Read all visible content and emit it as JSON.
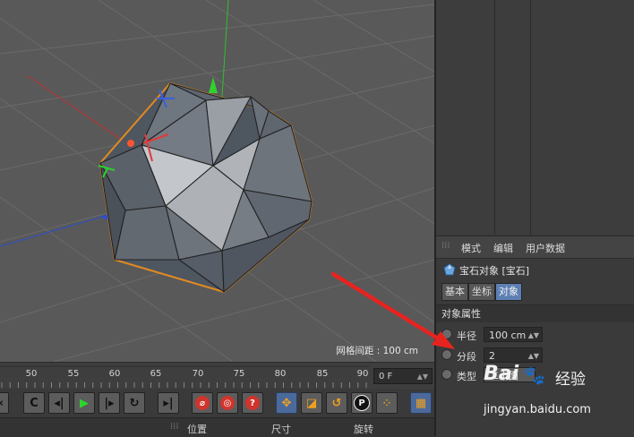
{
  "viewport": {
    "grid_spacing_label": "网格间距 : 100 cm"
  },
  "timeline": {
    "ticks": [
      "50",
      "55",
      "60",
      "65",
      "70",
      "75",
      "80",
      "85",
      "90"
    ],
    "current_frame": "0 F"
  },
  "coordbar": {
    "position_label": "位置",
    "size_label": "尺寸",
    "rotation_label": "旋转"
  },
  "attributes": {
    "menu": [
      "模式",
      "编辑",
      "用户数据"
    ],
    "object_title": "宝石对象 [宝石]",
    "tabs": [
      "基本",
      "坐标",
      "对象"
    ],
    "active_tab": "对象",
    "section_title": "对象属性",
    "radius_label": "半径",
    "radius_value": "100 cm",
    "segments_label": "分段",
    "segments_value": "2",
    "type_label": "类型",
    "type_value": "二十面"
  },
  "watermark": {
    "brand": "Bai",
    "brand_suffix": "经验",
    "url": "jingyan.baidu.com"
  }
}
